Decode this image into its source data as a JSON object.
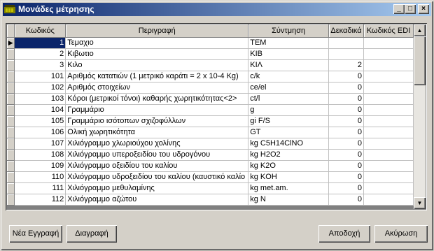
{
  "window": {
    "title": "Μονάδες μέτρησης",
    "controls": {
      "minimize": "_",
      "maximize": "□",
      "close": "×"
    }
  },
  "grid": {
    "columns": [
      "Κωδικός",
      "Περιγραφή",
      "Σύντμηση",
      "Δεκαδικά",
      "Κωδικός EDI"
    ],
    "current_row_indicator": "▶",
    "rows": [
      {
        "code": "1",
        "description": "Τεμαχιο",
        "abbr": "TEM",
        "decimals": "",
        "edi": ""
      },
      {
        "code": "2",
        "description": "Κιβωτιο",
        "abbr": "KIB",
        "decimals": "",
        "edi": ""
      },
      {
        "code": "3",
        "description": "Κιλο",
        "abbr": "ΚΙΛ",
        "decimals": "2",
        "edi": ""
      },
      {
        "code": "101",
        "description": "Αριθμός κατατιών (1 μετρικό καράτι = 2 x 10-4 Kg)",
        "abbr": "c/k",
        "decimals": "0",
        "edi": ""
      },
      {
        "code": "102",
        "description": "Αριθμός στοιχείων",
        "abbr": "ce/el",
        "decimals": "0",
        "edi": ""
      },
      {
        "code": "103",
        "description": "Κόροι (μετρικοί τόνοι) καθαρής χωρητικότητας<2>",
        "abbr": "ct/l",
        "decimals": "0",
        "edi": ""
      },
      {
        "code": "104",
        "description": "Γραμμάριο",
        "abbr": "g",
        "decimals": "0",
        "edi": ""
      },
      {
        "code": "105",
        "description": "Γραμμάριο ισότοπων σχιζοφύλλων",
        "abbr": "gi F/S",
        "decimals": "0",
        "edi": ""
      },
      {
        "code": "106",
        "description": "Ολική χωρητικότητα",
        "abbr": "GT",
        "decimals": "0",
        "edi": ""
      },
      {
        "code": "107",
        "description": "Χιλιόγραμμο χλωριούχου χολίνης",
        "abbr": "kg C5H14ClNO",
        "decimals": "0",
        "edi": ""
      },
      {
        "code": "108",
        "description": "Χιλιόγραμμο υπεροξειδίου του υδρογόνου",
        "abbr": "kg H2O2",
        "decimals": "0",
        "edi": ""
      },
      {
        "code": "109",
        "description": "Χιλιόγραμμο οξειδίου του καλίου",
        "abbr": "kg K2O",
        "decimals": "0",
        "edi": ""
      },
      {
        "code": "110",
        "description": "Χιλιόγραμμο υδροξειδίου του καλίου (καυστικό καλίο",
        "abbr": "kg KOH",
        "decimals": "0",
        "edi": ""
      },
      {
        "code": "111",
        "description": "Χιλιόγραμμο μεθυλαμίνης",
        "abbr": "kg met.am.",
        "decimals": "0",
        "edi": ""
      },
      {
        "code": "112",
        "description": "Χιλιόγραμμο αζώτου",
        "abbr": "kg N",
        "decimals": "0",
        "edi": ""
      }
    ],
    "scroll_up": "▲",
    "scroll_down": "▼"
  },
  "buttons": {
    "new_record": "Νέα Εγγραφή",
    "delete": "Διαγραφή",
    "accept": "Αποδοχή",
    "cancel": "Ακύρωση"
  },
  "colors": {
    "title_start": "#0a246a",
    "title_end": "#a6caf0",
    "selection": "#0a246a",
    "face": "#d4d0c8"
  }
}
